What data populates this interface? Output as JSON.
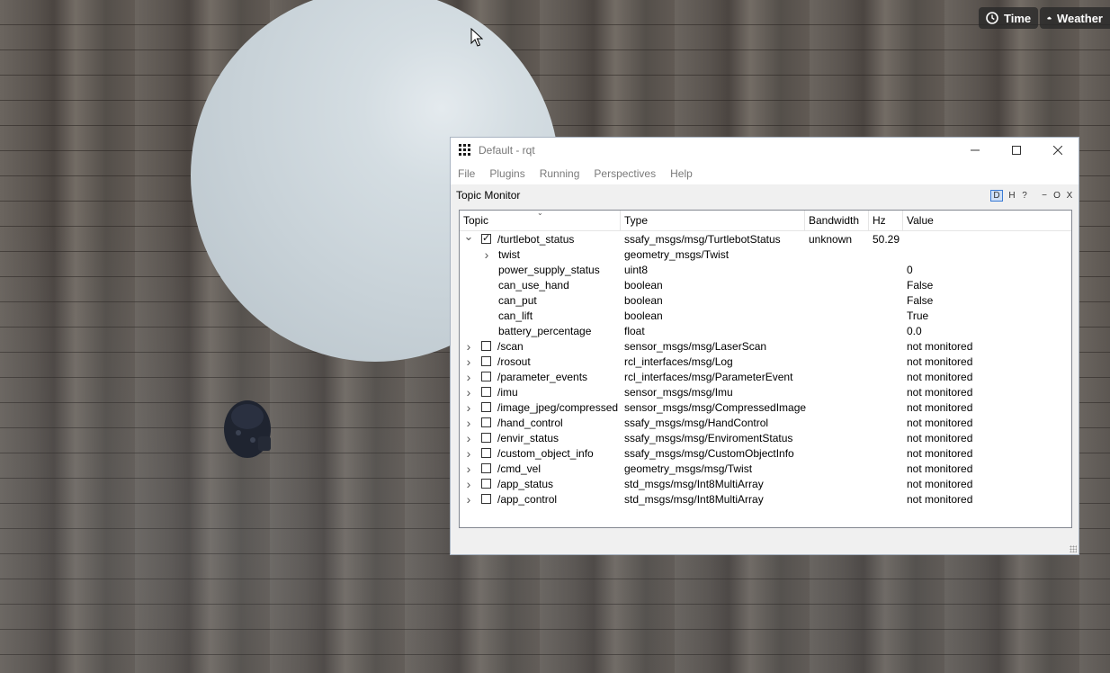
{
  "toolbar": {
    "time_label": "Time",
    "weather_label": "Weather"
  },
  "window": {
    "title": "Default - rqt",
    "menu": [
      "File",
      "Plugins",
      "Running",
      "Perspectives",
      "Help"
    ],
    "plugin_title": "Topic Monitor",
    "dock_buttons": [
      "D",
      "H",
      "?",
      "−",
      "O",
      "X"
    ]
  },
  "table": {
    "headers": [
      "Topic",
      "Type",
      "Bandwidth",
      "Hz",
      "Value"
    ],
    "rows": [
      {
        "topic": "/turtlebot_status",
        "type": "ssafy_msgs/msg/TurtlebotStatus",
        "bandwidth": "unknown",
        "hz": "50.29",
        "value": "",
        "level": 0,
        "checked": true,
        "expander": "down"
      },
      {
        "topic": "twist",
        "type": "geometry_msgs/Twist",
        "bandwidth": "",
        "hz": "",
        "value": "",
        "level": 1,
        "expander": "right"
      },
      {
        "topic": "power_supply_status",
        "type": "uint8",
        "bandwidth": "",
        "hz": "",
        "value": "0",
        "level": 1
      },
      {
        "topic": "can_use_hand",
        "type": "boolean",
        "bandwidth": "",
        "hz": "",
        "value": "False",
        "level": 1
      },
      {
        "topic": "can_put",
        "type": "boolean",
        "bandwidth": "",
        "hz": "",
        "value": "False",
        "level": 1
      },
      {
        "topic": "can_lift",
        "type": "boolean",
        "bandwidth": "",
        "hz": "",
        "value": "True",
        "level": 1
      },
      {
        "topic": "battery_percentage",
        "type": "float",
        "bandwidth": "",
        "hz": "",
        "value": "0.0",
        "level": 1
      },
      {
        "topic": "/scan",
        "type": "sensor_msgs/msg/LaserScan",
        "bandwidth": "",
        "hz": "",
        "value": "not monitored",
        "level": 0,
        "checked": false,
        "expander": "right"
      },
      {
        "topic": "/rosout",
        "type": "rcl_interfaces/msg/Log",
        "bandwidth": "",
        "hz": "",
        "value": "not monitored",
        "level": 0,
        "checked": false,
        "expander": "right"
      },
      {
        "topic": "/parameter_events",
        "type": "rcl_interfaces/msg/ParameterEvent",
        "bandwidth": "",
        "hz": "",
        "value": "not monitored",
        "level": 0,
        "checked": false,
        "expander": "right"
      },
      {
        "topic": "/imu",
        "type": "sensor_msgs/msg/Imu",
        "bandwidth": "",
        "hz": "",
        "value": "not monitored",
        "level": 0,
        "checked": false,
        "expander": "right"
      },
      {
        "topic": "/image_jpeg/compressed",
        "type": "sensor_msgs/msg/CompressedImage",
        "bandwidth": "",
        "hz": "",
        "value": "not monitored",
        "level": 0,
        "checked": false,
        "expander": "right"
      },
      {
        "topic": "/hand_control",
        "type": "ssafy_msgs/msg/HandControl",
        "bandwidth": "",
        "hz": "",
        "value": "not monitored",
        "level": 0,
        "checked": false,
        "expander": "right"
      },
      {
        "topic": "/envir_status",
        "type": "ssafy_msgs/msg/EnviromentStatus",
        "bandwidth": "",
        "hz": "",
        "value": "not monitored",
        "level": 0,
        "checked": false,
        "expander": "right"
      },
      {
        "topic": "/custom_object_info",
        "type": "ssafy_msgs/msg/CustomObjectInfo",
        "bandwidth": "",
        "hz": "",
        "value": "not monitored",
        "level": 0,
        "checked": false,
        "expander": "right"
      },
      {
        "topic": "/cmd_vel",
        "type": "geometry_msgs/msg/Twist",
        "bandwidth": "",
        "hz": "",
        "value": "not monitored",
        "level": 0,
        "checked": false,
        "expander": "right"
      },
      {
        "topic": "/app_status",
        "type": "std_msgs/msg/Int8MultiArray",
        "bandwidth": "",
        "hz": "",
        "value": "not monitored",
        "level": 0,
        "checked": false,
        "expander": "right"
      },
      {
        "topic": "/app_control",
        "type": "std_msgs/msg/Int8MultiArray",
        "bandwidth": "",
        "hz": "",
        "value": "not monitored",
        "level": 0,
        "checked": false,
        "expander": "right"
      }
    ]
  }
}
